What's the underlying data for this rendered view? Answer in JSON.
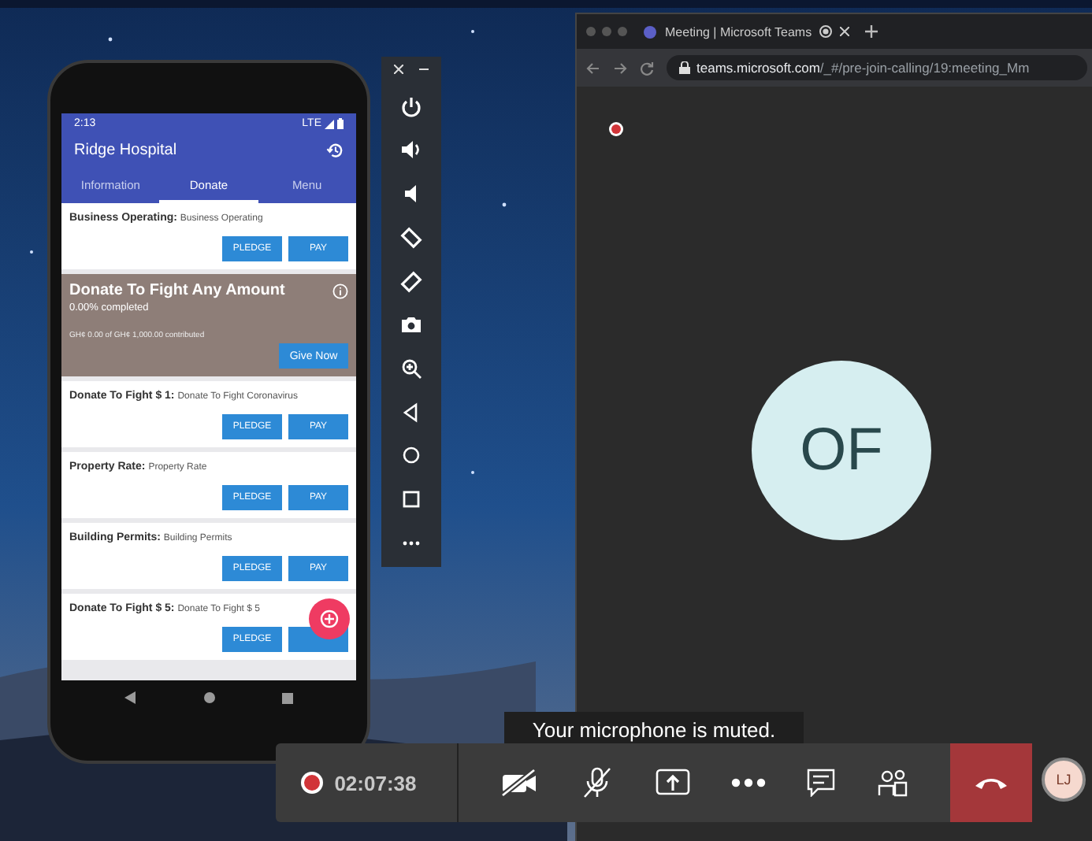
{
  "phone": {
    "status_time": "2:13",
    "network": "LTE",
    "app_title": "Ridge Hospital",
    "tabs": [
      {
        "label": "Information",
        "selected": false
      },
      {
        "label": "Donate",
        "selected": true
      },
      {
        "label": "Menu",
        "selected": false
      }
    ],
    "items": [
      {
        "kind": "payment",
        "title": "Business Operating:",
        "subtitle": "Business Operating",
        "buttons": [
          "PLEDGE",
          "PAY"
        ]
      },
      {
        "kind": "campaign",
        "title": "Donate To Fight Any Amount",
        "progress": "0.00% completed",
        "contributed": "GH¢ 0.00 of GH¢ 1,000.00 contributed",
        "button": "Give Now"
      },
      {
        "kind": "payment",
        "title": "Donate To Fight $ 1:",
        "subtitle": "Donate To Fight Coronavirus",
        "buttons": [
          "PLEDGE",
          "PAY"
        ]
      },
      {
        "kind": "payment",
        "title": "Property Rate:",
        "subtitle": "Property Rate",
        "buttons": [
          "PLEDGE",
          "PAY"
        ]
      },
      {
        "kind": "payment",
        "title": "Building Permits:",
        "subtitle": "Building Permits",
        "buttons": [
          "PLEDGE",
          "PAY"
        ]
      },
      {
        "kind": "payment",
        "title": "Donate To Fight $ 5:",
        "subtitle": "Donate To Fight $ 5",
        "buttons": [
          "PLEDGE"
        ]
      }
    ]
  },
  "browser": {
    "tab_title": "Meeting | Microsoft Teams",
    "url_host": "teams.microsoft.com",
    "url_path": "/_#/pre-join-calling/19:meeting_Mm"
  },
  "meeting": {
    "participant_initials": "OF",
    "toast": "Your microphone is muted.",
    "timer": "02:07:38",
    "camera_on": false,
    "mic_muted": true,
    "user_initials": "LJ"
  }
}
